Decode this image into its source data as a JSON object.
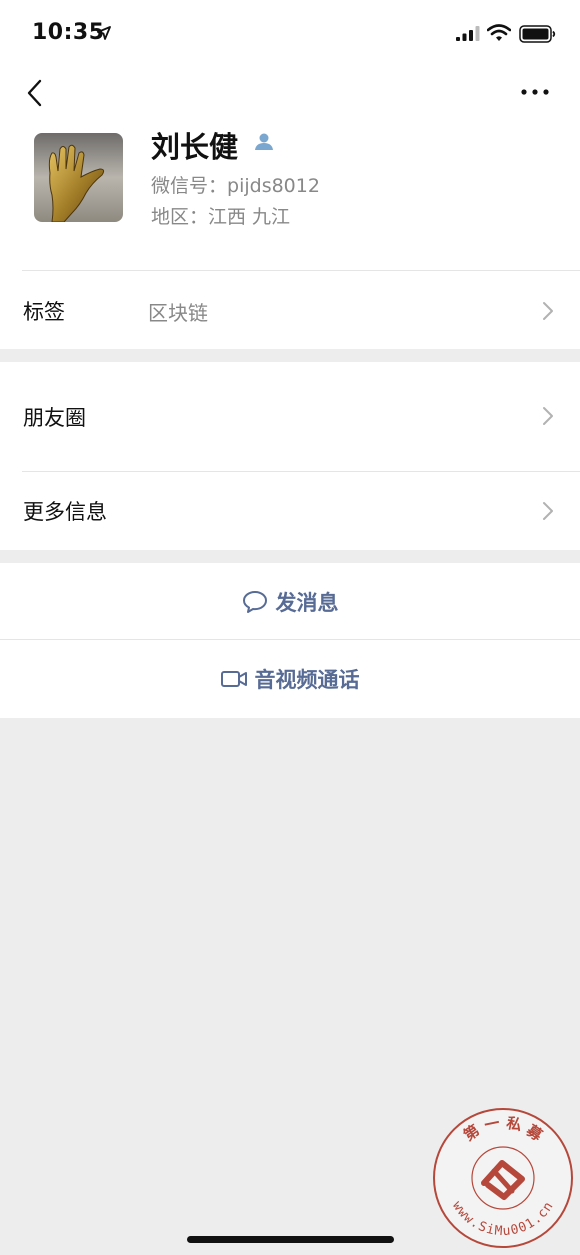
{
  "status_bar": {
    "time": "10:35"
  },
  "profile": {
    "name": "刘长健",
    "wechat_id_label": "微信号：",
    "wechat_id": "pijds8012",
    "region_label": "地区：",
    "region": "江西 九江"
  },
  "rows": {
    "tag_label": "标签",
    "tag_value": "区块链",
    "moments_label": "朋友圈",
    "more_info_label": "更多信息"
  },
  "actions": {
    "message_label": "发消息",
    "call_label": "音视频通话"
  },
  "watermark": {
    "top_text": "第 一 私 募",
    "bottom_text": "www.SiMu001.cn"
  },
  "colors": {
    "link": "#576b95",
    "page_background": "#ededed",
    "secondary_text": "#888888",
    "watermark": "#b5483b"
  }
}
